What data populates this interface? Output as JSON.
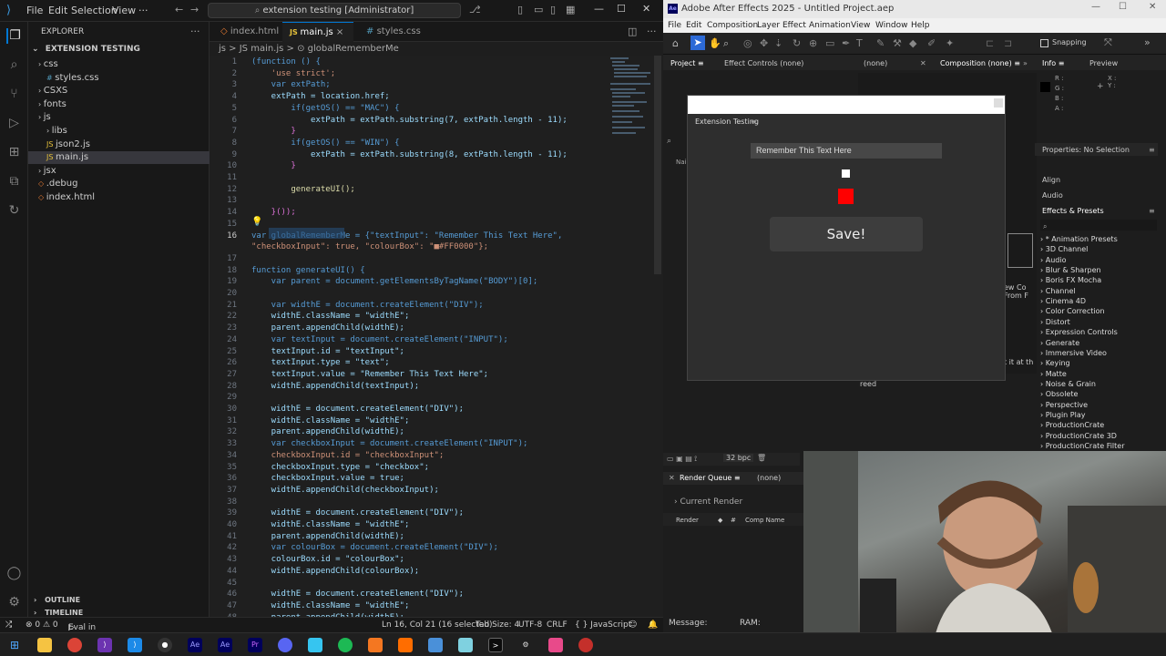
{
  "vscode": {
    "menu": [
      "File",
      "Edit",
      "Selection",
      "View",
      "···"
    ],
    "search": "extension testing [Administrator]",
    "explorer_title": "EXPLORER",
    "project": "EXTENSION TESTING",
    "tree": [
      {
        "label": "css",
        "indent": 1,
        "kind": "folder"
      },
      {
        "label": "styles.css",
        "indent": 2,
        "kind": "file"
      },
      {
        "label": "CSXS",
        "indent": 1,
        "kind": "folder"
      },
      {
        "label": "fonts",
        "indent": 1,
        "kind": "folder"
      },
      {
        "label": "js",
        "indent": 1,
        "kind": "folder"
      },
      {
        "label": "libs",
        "indent": 2,
        "kind": "folder"
      },
      {
        "label": "json2.js",
        "indent": 2,
        "kind": "file"
      },
      {
        "label": "main.js",
        "indent": 2,
        "kind": "file"
      },
      {
        "label": "jsx",
        "indent": 1,
        "kind": "folder"
      },
      {
        "label": ".debug",
        "indent": 1,
        "kind": "file"
      },
      {
        "label": "index.html",
        "indent": 1,
        "kind": "file"
      }
    ],
    "outline": "OUTLINE",
    "timeline": "TIMELINE",
    "tabs": [
      {
        "label": "index.html",
        "active": false
      },
      {
        "label": "main.js",
        "active": true
      },
      {
        "label": "styles.css",
        "active": false
      }
    ],
    "breadcrumb": "js  >  JS main.js  >  ⊙ globalRememberMe",
    "lines": [
      {
        "n": "1",
        "t": "(function () {"
      },
      {
        "n": "2",
        "t": "    'use strict';"
      },
      {
        "n": "3",
        "t": "    var extPath;"
      },
      {
        "n": "4",
        "t": "    extPath = location.href;"
      },
      {
        "n": "5",
        "t": "        if(getOS() == \"MAC\") {"
      },
      {
        "n": "6",
        "t": "            extPath = extPath.substring(7, extPath.length - 11);"
      },
      {
        "n": "7",
        "t": "        }"
      },
      {
        "n": "8",
        "t": "        if(getOS() == \"WIN\") {"
      },
      {
        "n": "9",
        "t": "            extPath = extPath.substring(8, extPath.length - 11);"
      },
      {
        "n": "10",
        "t": "        }"
      },
      {
        "n": "11",
        "t": ""
      },
      {
        "n": "12",
        "t": "        generateUI();"
      },
      {
        "n": "13",
        "t": ""
      },
      {
        "n": "14",
        "t": "    }());"
      },
      {
        "n": "15",
        "t": ""
      },
      {
        "n": "16",
        "t": "var globalRememberMe = {\"textInput\": \"Remember This Text Here\","
      },
      {
        "n": "",
        "t": "\"checkboxInput\": true, \"colourBox\": \"■#FF0000\"};"
      },
      {
        "n": "17",
        "t": ""
      },
      {
        "n": "18",
        "t": "function generateUI() {"
      },
      {
        "n": "19",
        "t": "    var parent = document.getElementsByTagName(\"BODY\")[0];"
      },
      {
        "n": "20",
        "t": ""
      },
      {
        "n": "21",
        "t": "    var widthE = document.createElement(\"DIV\");"
      },
      {
        "n": "22",
        "t": "    widthE.className = \"widthE\";"
      },
      {
        "n": "23",
        "t": "    parent.appendChild(widthE);"
      },
      {
        "n": "24",
        "t": "    var textInput = document.createElement(\"INPUT\");"
      },
      {
        "n": "25",
        "t": "    textInput.id = \"textInput\";"
      },
      {
        "n": "26",
        "t": "    textInput.type = \"text\";"
      },
      {
        "n": "27",
        "t": "    textInput.value = \"Remember This Text Here\";"
      },
      {
        "n": "28",
        "t": "    widthE.appendChild(textInput);"
      },
      {
        "n": "29",
        "t": ""
      },
      {
        "n": "30",
        "t": "    widthE = document.createElement(\"DIV\");"
      },
      {
        "n": "31",
        "t": "    widthE.className = \"widthE\";"
      },
      {
        "n": "32",
        "t": "    parent.appendChild(widthE);"
      },
      {
        "n": "33",
        "t": "    var checkboxInput = document.createElement(\"INPUT\");"
      },
      {
        "n": "34",
        "t": "    checkboxInput.id = \"checkboxInput\";"
      },
      {
        "n": "35",
        "t": "    checkboxInput.type = \"checkbox\";"
      },
      {
        "n": "36",
        "t": "    checkboxInput.value = true;"
      },
      {
        "n": "37",
        "t": "    widthE.appendChild(checkboxInput);"
      },
      {
        "n": "38",
        "t": ""
      },
      {
        "n": "39",
        "t": "    widthE = document.createElement(\"DIV\");"
      },
      {
        "n": "40",
        "t": "    widthE.className = \"widthE\";"
      },
      {
        "n": "41",
        "t": "    parent.appendChild(widthE);"
      },
      {
        "n": "42",
        "t": "    var colourBox = document.createElement(\"DIV\");"
      },
      {
        "n": "43",
        "t": "    colourBox.id = \"colourBox\";"
      },
      {
        "n": "44",
        "t": "    widthE.appendChild(colourBox);"
      },
      {
        "n": "45",
        "t": ""
      },
      {
        "n": "46",
        "t": "    widthE = document.createElement(\"DIV\");"
      },
      {
        "n": "47",
        "t": "    widthE.className = \"widthE\";"
      },
      {
        "n": "48",
        "t": "    parent.appendChild(widthE);"
      }
    ],
    "status": {
      "errors": "⊗ 0  ⚠ 0",
      "eval": "Eval in Adobe...",
      "position": "Ln 16, Col 21 (16 selected)",
      "tabsize": "Tab Size: 4",
      "encoding": "UTF-8",
      "eol": "CRLF",
      "language": "{ } JavaScript"
    }
  },
  "ae": {
    "title": "Adobe After Effects 2025 - Untitled Project.aep",
    "menu": [
      "File",
      "Edit",
      "Composition",
      "Layer",
      "Effect",
      "Animation",
      "View",
      "Window",
      "Help"
    ],
    "snapping": "Snapping",
    "panels": {
      "project": "Project",
      "effect_controls": "Effect Controls (none)",
      "none1": "(none)",
      "composition": "Composition (none)",
      "info": "Info",
      "preview": "Preview",
      "properties": "Properties: No Selection",
      "align": "Align",
      "audio": "Audio",
      "effects_presets": "Effects & Presets",
      "render_queue": "Render Queue",
      "render_none": "(none)",
      "current_render": "Current Render",
      "render_col": "Render",
      "hash_col": "#",
      "comp_name_col": "Comp Name",
      "bpc": "32 bpc",
      "message": "Message:",
      "ram": "RAM:",
      "reed": "reed"
    },
    "info": {
      "r": "R :",
      "g": "G :",
      "b": "B :",
      "a": "A :",
      "x": "X :",
      "y": "Y :"
    },
    "effects": [
      "* Animation Presets",
      "3D Channel",
      "Audio",
      "Blur & Sharpen",
      "Boris FX Mocha",
      "Channel",
      "Cinema 4D",
      "Color Correction",
      "Distort",
      "Expression Controls",
      "Generate",
      "Immersive Video",
      "Keying",
      "Matte",
      "Noise & Grain",
      "Obsolete",
      "Perspective",
      "Plugin Play",
      "ProductionCrate",
      "ProductionCrate 3D",
      "ProductionCrate Filter"
    ],
    "extension": {
      "title": "Extension Testing",
      "input_value": "Remember This Text Here",
      "colour": "#FF0000",
      "save": "Save!"
    }
  },
  "colors": {
    "accent": "#0078d4",
    "red": "#ee1111"
  }
}
